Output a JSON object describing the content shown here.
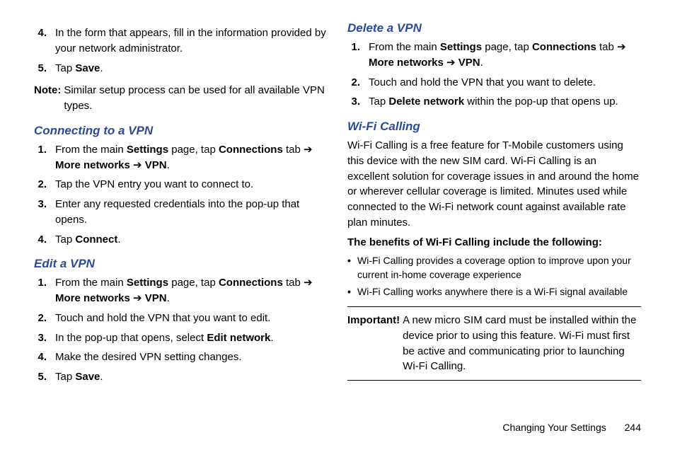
{
  "left": {
    "cont_steps": [
      {
        "n": "4.",
        "html": "In the form that appears, fill in the information provided by your network administrator."
      },
      {
        "n": "5.",
        "html": "Tap <b>Save</b>."
      }
    ],
    "note_label": "Note:",
    "note_body": "Similar setup process can be used for all available VPN types.",
    "h_connect": "Connecting to a VPN",
    "connect_steps": [
      {
        "n": "1.",
        "html": "From the main <b>Settings</b> page, tap <b>Connections</b> tab ➔ <b>More networks</b> ➔ <b>VPN</b>."
      },
      {
        "n": "2.",
        "html": "Tap the VPN entry you want to connect to."
      },
      {
        "n": "3.",
        "html": "Enter any requested credentials into the pop-up that opens."
      },
      {
        "n": "4.",
        "html": "Tap <b>Connect</b>."
      }
    ],
    "h_edit": "Edit a VPN",
    "edit_steps": [
      {
        "n": "1.",
        "html": "From the main <b>Settings</b> page, tap <b>Connections</b> tab ➔ <b>More networks</b> ➔ <b>VPN</b>."
      },
      {
        "n": "2.",
        "html": "Touch and hold the VPN that you want to edit."
      },
      {
        "n": "3.",
        "html": "In the pop-up that opens, select <b>Edit network</b>."
      },
      {
        "n": "4.",
        "html": "Make the desired VPN setting changes."
      },
      {
        "n": "5.",
        "html": "Tap <b>Save</b>."
      }
    ]
  },
  "right": {
    "h_delete": "Delete a VPN",
    "delete_steps": [
      {
        "n": "1.",
        "html": "From the main <b>Settings</b> page, tap <b>Connections</b> tab ➔ <b>More networks</b> ➔ <b>VPN</b>."
      },
      {
        "n": "2.",
        "html": "Touch and hold the VPN that you want to delete."
      },
      {
        "n": "3.",
        "html": "Tap <b>Delete network</b> within the pop-up that opens up."
      }
    ],
    "h_wifi": "Wi-Fi Calling",
    "wifi_para": "Wi-Fi Calling is a free feature for T-Mobile customers using this device with the new SIM card. Wi-Fi Calling is an excellent solution for coverage issues in and around the home or wherever cellular coverage is limited. Minutes used while connected to the Wi-Fi network count against available rate plan minutes.",
    "benefits_heading": "The benefits of Wi-Fi Calling include the following:",
    "benefits": [
      "Wi-Fi Calling provides a coverage option to improve upon your current in-home coverage experience",
      "Wi-Fi Calling works anywhere there is a Wi-Fi signal available"
    ],
    "important_label": "Important!",
    "important_body": "A new micro SIM card must be installed within the device prior to using this feature. Wi-Fi must first be active and communicating prior to launching Wi-Fi Calling."
  },
  "footer": {
    "section": "Changing Your Settings",
    "page": "244"
  }
}
